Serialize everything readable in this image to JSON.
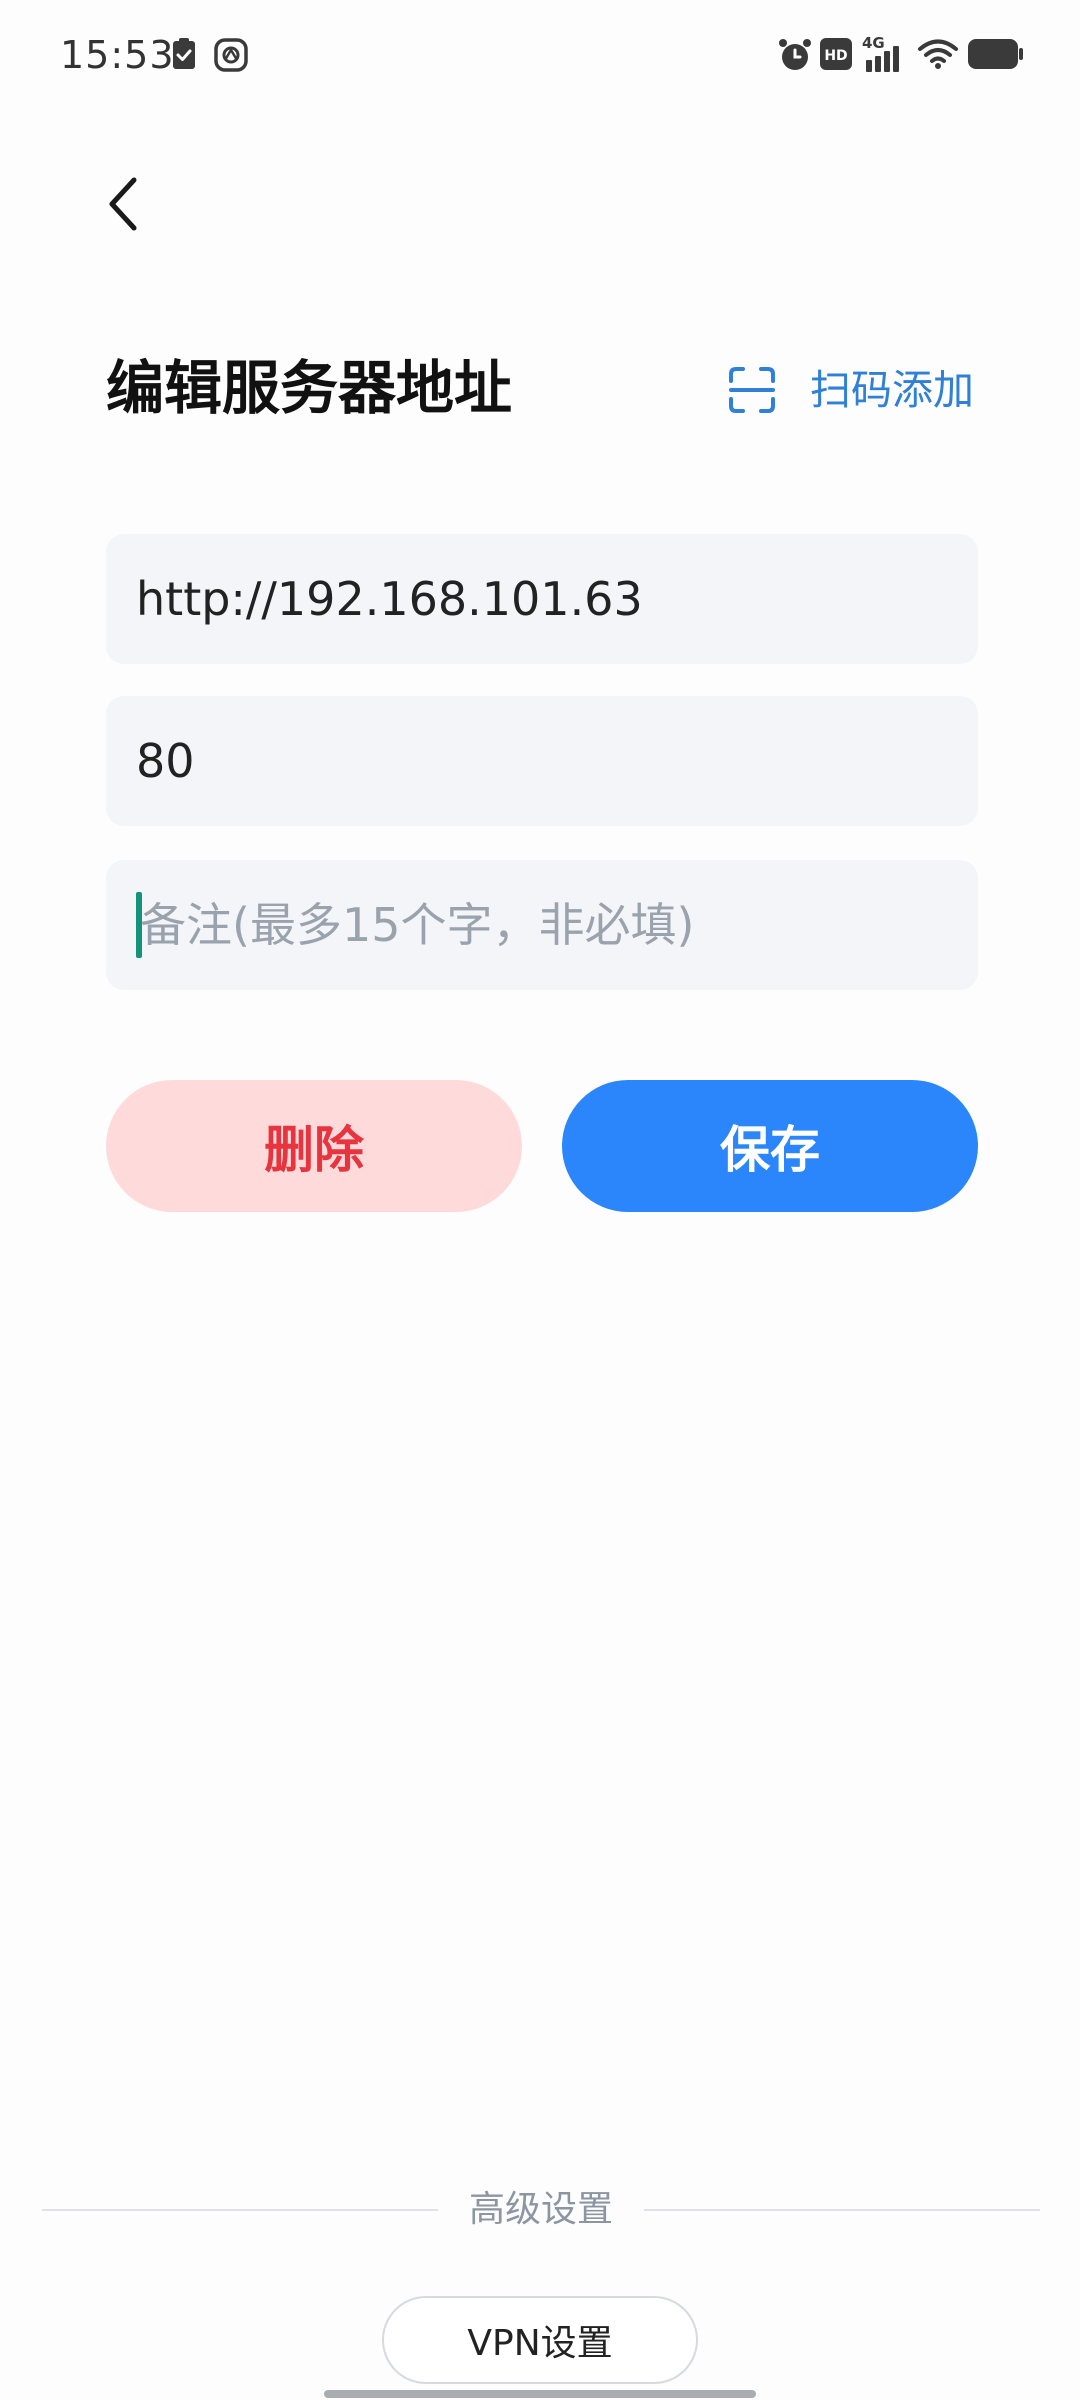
{
  "status_bar": {
    "time": "15:53",
    "left_icons": [
      "clipboard-check-icon",
      "assistant-app-icon"
    ],
    "right_icons": [
      "alarm-icon",
      "hd-icon",
      "signal-4g-icon",
      "wifi-icon",
      "battery-icon"
    ],
    "network_label": "4G",
    "hd_label": "HD"
  },
  "header": {
    "back_icon": "chevron-left-icon",
    "title": "编辑服务器地址",
    "scan_add": {
      "icon": "scan-icon",
      "label": "扫码添加"
    }
  },
  "form": {
    "address": {
      "value": "http://192.168.101.63"
    },
    "port": {
      "value": "80"
    },
    "note": {
      "value": "",
      "placeholder": "备注(最多15个字，非必填)"
    }
  },
  "actions": {
    "delete_label": "删除",
    "save_label": "保存"
  },
  "footer": {
    "advanced_label": "高级设置",
    "vpn_label": "VPN设置"
  },
  "colors": {
    "accent": "#2a86fa",
    "link": "#2f80d6",
    "danger_text": "#e7343f",
    "danger_bg": "#ffdadb",
    "field_bg": "#f3f5f9",
    "cursor": "#14937a"
  }
}
